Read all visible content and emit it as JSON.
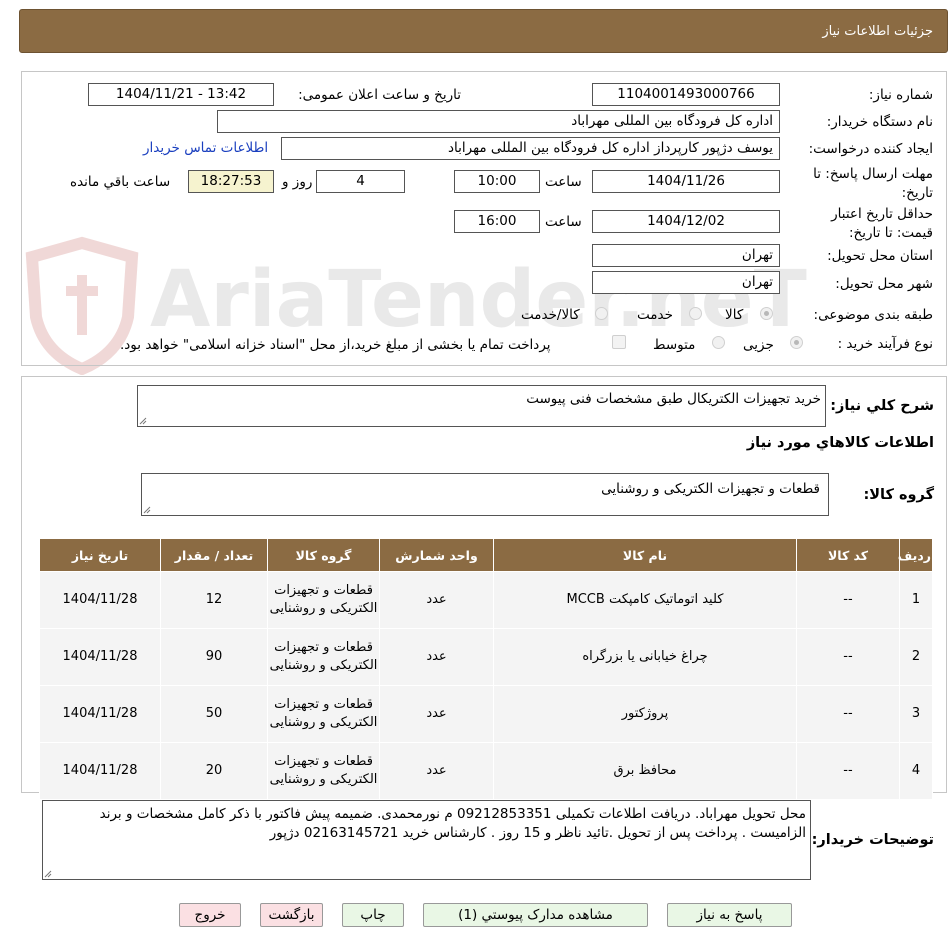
{
  "header": {
    "title": "جزئیات اطلاعات نیاز"
  },
  "watermark": {
    "text": "AriaTender.neT"
  },
  "fields": {
    "need_number_label": "شماره نیاز:",
    "need_number": "1104001493000766",
    "announce_label": "تاریخ و ساعت اعلان عمومی:",
    "announce_value": "1404/11/21 - 13:42",
    "buyer_org_label": "نام دستگاه خریدار:",
    "buyer_org": "اداره کل فرودگاه بین المللی مهراباد",
    "creator_label": "ایجاد کننده درخواست:",
    "creator": "یوسف دژپور کارپرداز اداره کل فرودگاه بین المللی مهراباد",
    "contact_link": "اطلاعات تماس خریدار",
    "deadline_label": "مهلت ارسال پاسخ: تا تاریخ:",
    "deadline_date": "1404/11/26",
    "time_label": "ساعت",
    "deadline_time": "10:00",
    "days_value": "4",
    "days_label": "روز و",
    "remaining_time": "18:27:53",
    "remaining_label": "ساعت باقي مانده",
    "validity_label": "حداقل تاریخ اعتبار قیمت: تا تاریخ:",
    "validity_date": "1404/12/02",
    "validity_time": "16:00",
    "province_label": "استان محل تحویل:",
    "province": "تهران",
    "city_label": "شهر محل تحویل:",
    "city": "تهران",
    "category_label": "طبقه بندی موضوعی:",
    "category_options": [
      "کالا",
      "خدمت",
      "کالا/خدمت"
    ],
    "process_label": "نوع فرآیند خرید :",
    "process_options": [
      "جزیی",
      "متوسط"
    ],
    "payment_note": "پرداخت تمام یا بخشی از مبلغ خرید،از محل \"اسناد خزانه اسلامی\" خواهد بود."
  },
  "summary": {
    "label": "شرح کلي نياز:",
    "value": "خرید تجهیزات الکتریکال طبق مشخصات فنی پیوست"
  },
  "goods": {
    "section_title": "اطلاعات کالاهاي مورد نياز",
    "group_label": "گروه کالا:",
    "group_value": "قطعات و تجهیزات الکتریکی و روشنایی"
  },
  "table": {
    "headers": [
      "رديف",
      "کد کالا",
      "نام کالا",
      "واحد شمارش",
      "گروه کالا",
      "تعداد / مقدار",
      "تاریخ نیاز"
    ],
    "rows": [
      [
        "1",
        "--",
        "کلید اتوماتیک کامپکت MCCB",
        "عدد",
        "قطعات و تجهیزات الکتریکی و روشنایی",
        "12",
        "1404/11/28"
      ],
      [
        "2",
        "--",
        "چراغ خیابانی یا بزرگراه",
        "عدد",
        "قطعات و تجهیزات الکتریکی و روشنایی",
        "90",
        "1404/11/28"
      ],
      [
        "3",
        "--",
        "پروژکتور",
        "عدد",
        "قطعات و تجهیزات الکتریکی و روشنایی",
        "50",
        "1404/11/28"
      ],
      [
        "4",
        "--",
        "محافظ برق",
        "عدد",
        "قطعات و تجهیزات الکتریکی و روشنایی",
        "20",
        "1404/11/28"
      ]
    ]
  },
  "buyer_notes": {
    "label": "توضیحات خریدار:",
    "value": "محل تحویل مهراباد. دریافت اطلاعات تکمیلی 09212853351 م نورمحمدی. ضمیمه پیش فاکتور با ذکر کامل مشخصات و برند الزامیست . پرداخت پس از تحویل .تائید ناظر و 15 روز . کارشناس خرید 02163145721 دژپور"
  },
  "buttons": {
    "reply": "پاسخ به نیاز",
    "attachments": "مشاهده مدارک پیوستي (1)",
    "print": "چاپ",
    "back": "بازگشت",
    "exit": "خروج"
  }
}
